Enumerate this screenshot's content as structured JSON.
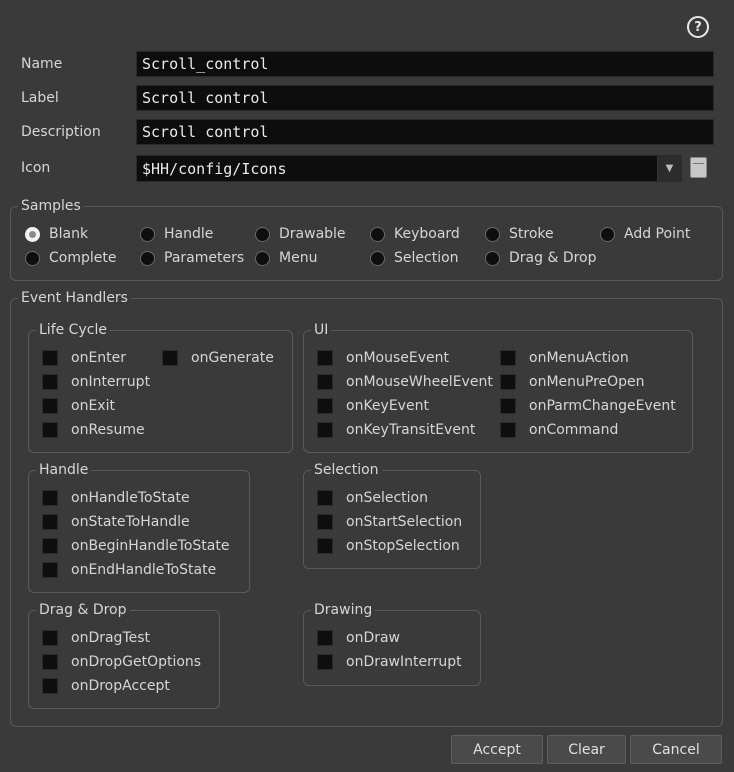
{
  "help_glyph": "?",
  "fields": {
    "name": {
      "label": "Name",
      "value": "Scroll_control"
    },
    "label": {
      "label": "Label",
      "value": "Scroll control"
    },
    "description": {
      "label": "Description",
      "value": "Scroll control"
    },
    "icon": {
      "label": "Icon",
      "value": "$HH/config/Icons"
    }
  },
  "samples": {
    "title": "Samples",
    "selected": "Blank",
    "options": [
      "Blank",
      "Handle",
      "Drawable",
      "Keyboard",
      "Stroke",
      "Add Point",
      "Complete",
      "Parameters",
      "Menu",
      "Selection",
      "Drag & Drop"
    ]
  },
  "event_handlers": {
    "title": "Event Handlers",
    "life_cycle": {
      "title": "Life Cycle",
      "items": [
        "onEnter",
        "onGenerate",
        "onInterrupt",
        "onExit",
        "onResume"
      ]
    },
    "ui": {
      "title": "UI",
      "items": [
        "onMouseEvent",
        "onMenuAction",
        "onMouseWheelEvent",
        "onMenuPreOpen",
        "onKeyEvent",
        "onParmChangeEvent",
        "onKeyTransitEvent",
        "onCommand"
      ]
    },
    "handle": {
      "title": "Handle",
      "items": [
        "onHandleToState",
        "onStateToHandle",
        "onBeginHandleToState",
        "onEndHandleToState"
      ]
    },
    "selection": {
      "title": "Selection",
      "items": [
        "onSelection",
        "onStartSelection",
        "onStopSelection"
      ]
    },
    "drag_drop": {
      "title": "Drag & Drop",
      "items": [
        "onDragTest",
        "onDropGetOptions",
        "onDropAccept"
      ]
    },
    "drawing": {
      "title": "Drawing",
      "items": [
        "onDraw",
        "onDrawInterrupt"
      ]
    }
  },
  "buttons": {
    "accept": "Accept",
    "clear": "Clear",
    "cancel": "Cancel"
  }
}
